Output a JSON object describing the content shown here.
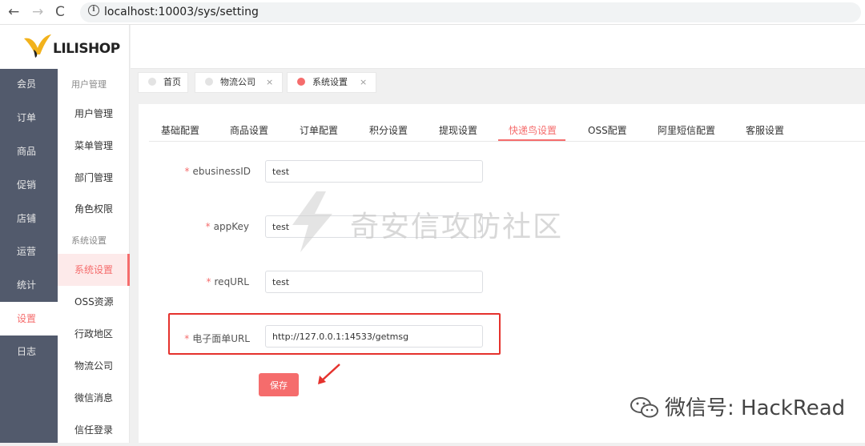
{
  "browser": {
    "url": "localhost:10003/sys/setting"
  },
  "logo": {
    "text": "LILISHOP"
  },
  "main_menu": [
    {
      "label": "会员"
    },
    {
      "label": "订单"
    },
    {
      "label": "商品"
    },
    {
      "label": "促销"
    },
    {
      "label": "店铺"
    },
    {
      "label": "运营"
    },
    {
      "label": "统计"
    },
    {
      "label": "设置",
      "active": true
    },
    {
      "label": "日志"
    }
  ],
  "sub_menu": {
    "group1": "用户管理",
    "items1": [
      "用户管理",
      "菜单管理",
      "部门管理",
      "角色权限"
    ],
    "group2": "系统设置",
    "items2": [
      "系统设置",
      "OSS资源",
      "行政地区",
      "物流公司",
      "微信消息",
      "信任登录"
    ]
  },
  "page_tabs": [
    {
      "label": "首页"
    },
    {
      "label": "物流公司",
      "close": "×"
    },
    {
      "label": "系统设置",
      "close": "×",
      "active": true
    }
  ],
  "setting_tabs": [
    "基础配置",
    "商品设置",
    "订单配置",
    "积分设置",
    "提现设置",
    "快递鸟设置",
    "OSS配置",
    "阿里短信配置",
    "客服设置"
  ],
  "form": {
    "fields": [
      {
        "label": "ebusinessID",
        "value": "test"
      },
      {
        "label": "appKey",
        "value": "test"
      },
      {
        "label": "reqURL",
        "value": "test"
      },
      {
        "label": "电子面单URL",
        "value": "http://127.0.0.1:14533/getmsg"
      }
    ],
    "required_mark": "*",
    "save_label": "保存"
  },
  "watermark": {
    "center": "奇安信攻防社区",
    "corner": "微信号: HackRead"
  },
  "colors": {
    "accent": "#f56c6c",
    "sidebar": "#525a6c",
    "highlight": "#e5322d"
  }
}
